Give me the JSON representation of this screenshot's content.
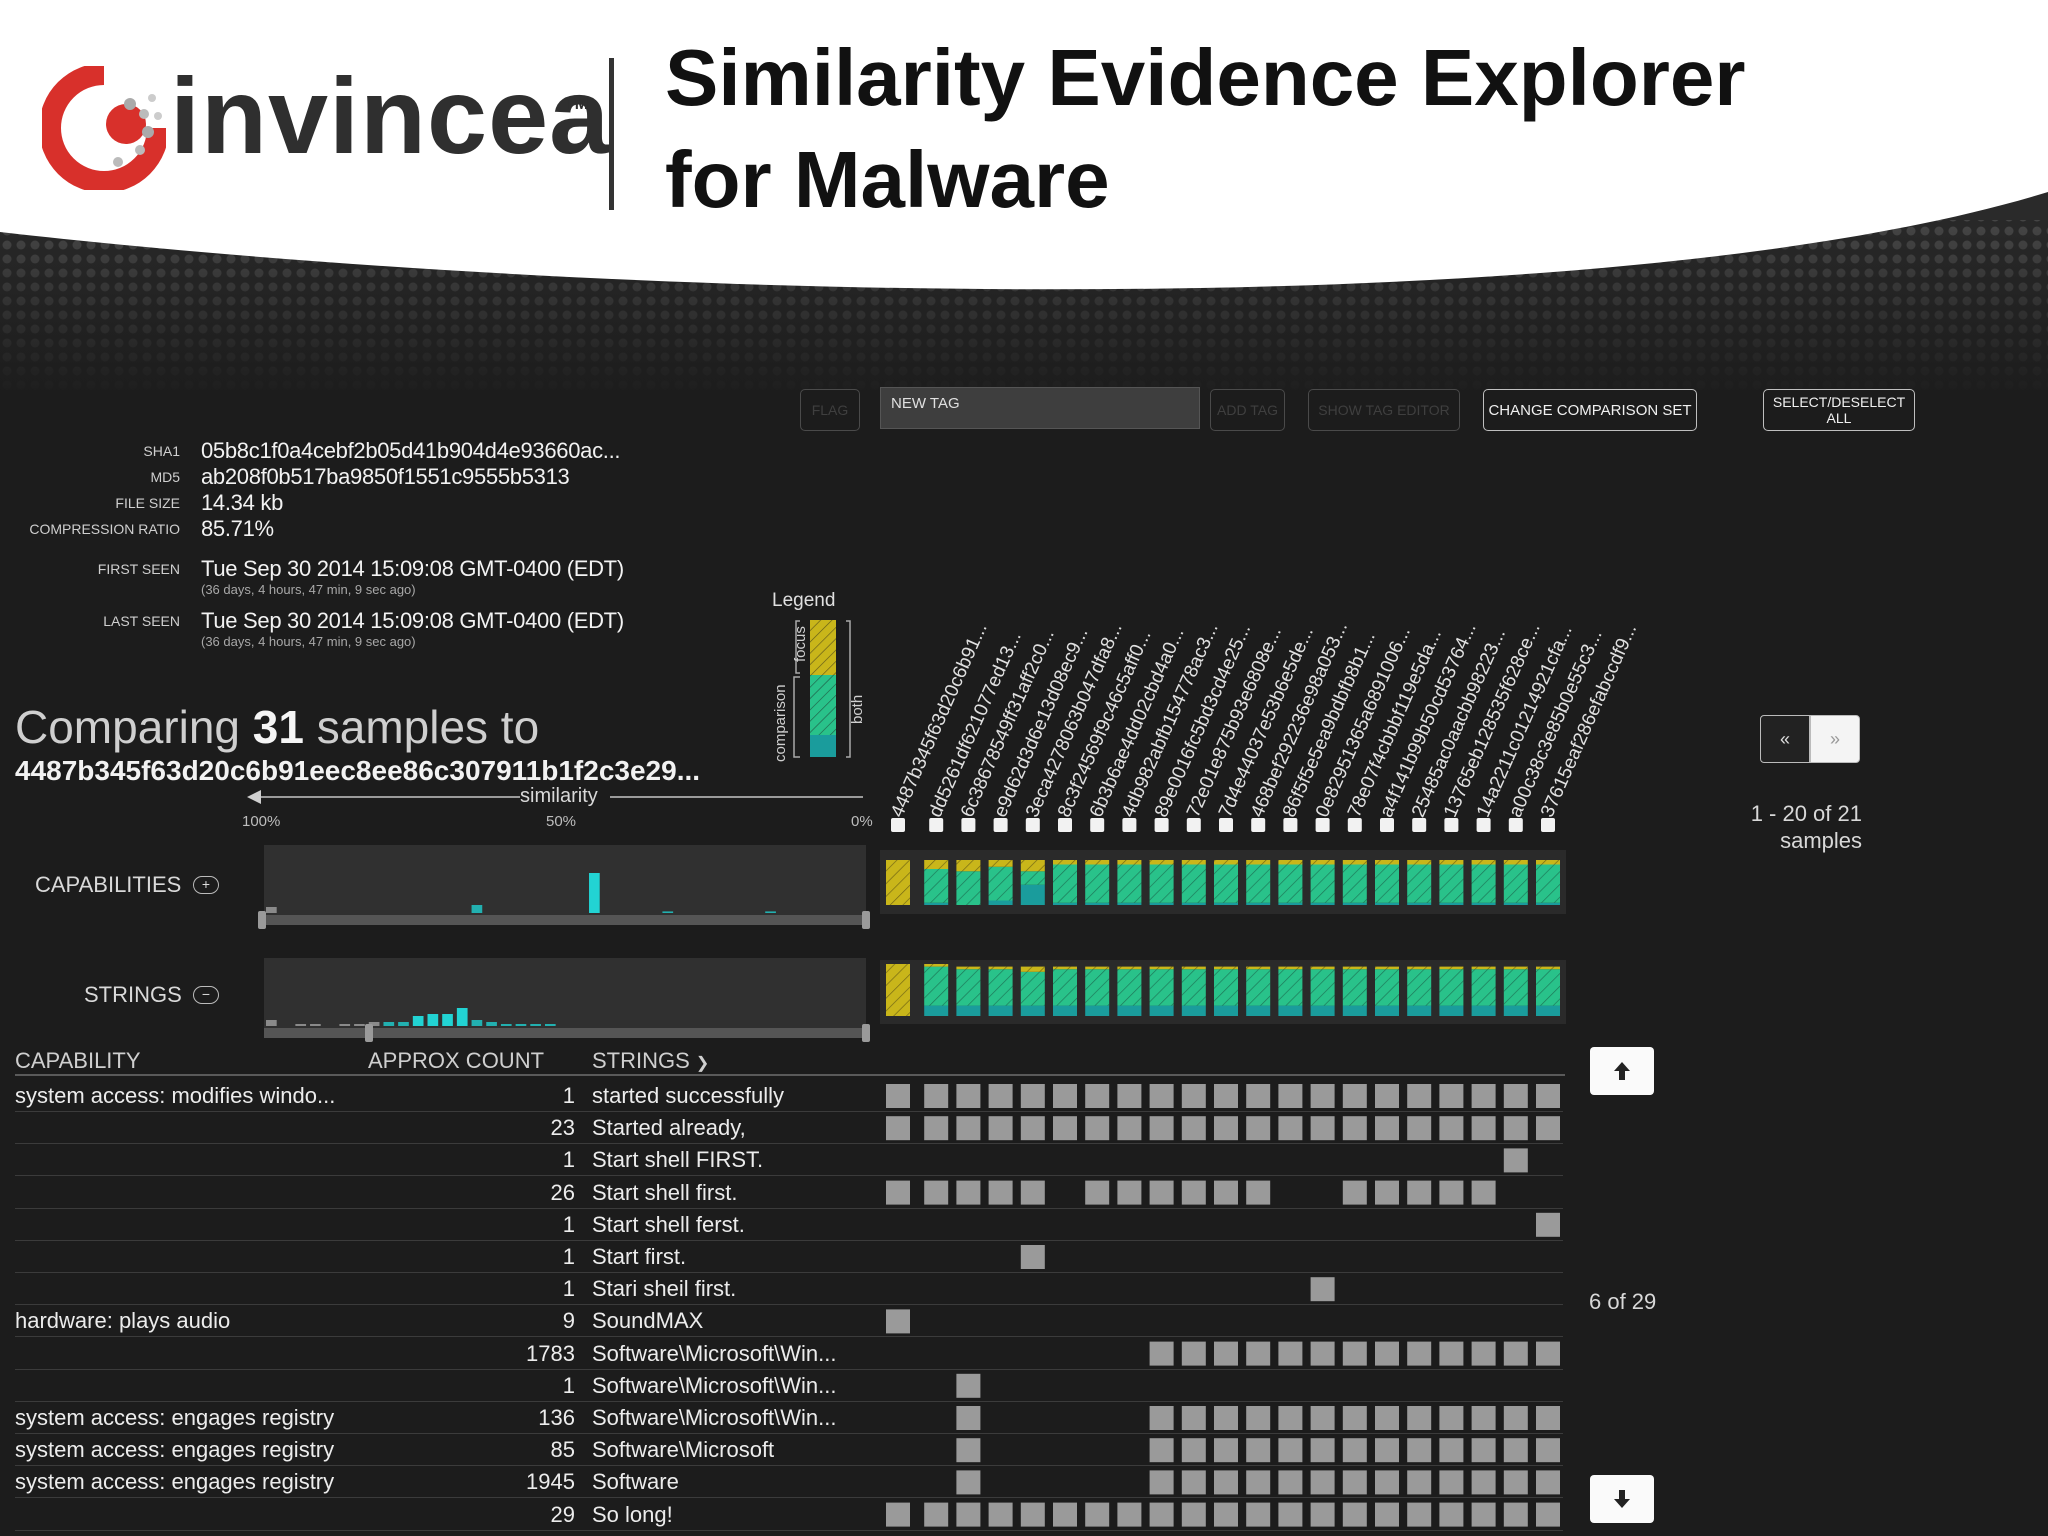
{
  "header": {
    "logo_text": "invincea",
    "logo_tm": "TM",
    "title_line1": "Similarity Evidence Explorer",
    "title_line2": "for Malware"
  },
  "toolbar": {
    "flag_label": "FLAG",
    "tag_placeholder": "NEW TAG",
    "add_tag_label": "ADD TAG",
    "show_tag_editor_label": "SHOW TAG EDITOR",
    "change_comparison_label": "CHANGE COMPARISON SET",
    "select_all_line1": "SELECT/DESELECT",
    "select_all_line2": "ALL"
  },
  "metadata": {
    "sha1_label": "SHA1",
    "sha1": "05b8c1f0a4cebf2b05d41b904d4e93660ac...",
    "md5_label": "MD5",
    "md5": "ab208f0b517ba9850f1551c9555b5313",
    "file_size_label": "FILE SIZE",
    "file_size": "14.34 kb",
    "compression_label": "COMPRESSION RATIO",
    "compression": "85.71%",
    "first_seen_label": "FIRST SEEN",
    "first_seen": "Tue Sep 30 2014 15:09:08 GMT-0400 (EDT)",
    "first_seen_ago": "(36 days, 4 hours, 47 min, 9 sec ago)",
    "last_seen_label": "LAST SEEN",
    "last_seen": "Tue Sep 30 2014 15:09:08 GMT-0400 (EDT)",
    "last_seen_ago": "(36 days, 4 hours, 47 min, 9 sec ago)"
  },
  "comparison": {
    "prefix": "Comparing ",
    "count": "31",
    "suffix": " samples to",
    "target_hash": "4487b345f63d20c6b91eec8ee86c307911b1f2c3e29...",
    "similarity_label": "similarity",
    "tick_100": "100%",
    "tick_50": "50%",
    "tick_0": "0%"
  },
  "legend": {
    "title": "Legend",
    "focus": "focus",
    "comparison": "comparison",
    "both": "both",
    "colors": {
      "focus": "#c9b61a",
      "both": "#29c28a",
      "comparison": "#1a9c9c"
    }
  },
  "sections": {
    "capabilities_label": "CAPABILITIES",
    "capabilities_toggle": "+",
    "strings_label": "STRINGS",
    "strings_toggle": "−"
  },
  "samples": [
    "4487b345f63d20c6b91...",
    "dd5261df621077ed13...",
    "6c38678549ff31aff2c0...",
    "e9d62d3d6e13d08ec9...",
    "3eca4278063b047dfa8...",
    "8c3f24569f9c46c5aff0...",
    "6b3b6ae4dd02cbd4a0...",
    "4db982abfb154778ac3...",
    "89e0016fc5bd3cd4e25...",
    "72e01e875b93e6808e...",
    "7d4e44037e53b6e5de...",
    "468bef292236e98a053...",
    "86f5f5e5ea9bdbfb8b1...",
    "0e82951365a6891006...",
    "78e07f4cbbbf119e5da...",
    "a4f141b99b50cd53764...",
    "25485ac0aacbb98223...",
    "13765eb128535f628ce...",
    "14a2211c01214921cfa...",
    "a00c38c3e85b0e55c3...",
    "37615eaf286efabccdf9..."
  ],
  "pager": {
    "prev": "«",
    "next": "»",
    "range_line1": "1 - 20 of 21",
    "range_line2": "samples",
    "rows_range": "6 of 29"
  },
  "table": {
    "headers": {
      "capability": "CAPABILITY",
      "count": "APPROX COUNT",
      "strings": "STRINGS"
    },
    "rows": [
      {
        "capability": "system access: modifies windo...",
        "count": "1",
        "string": "started successfully"
      },
      {
        "capability": "",
        "count": "23",
        "string": "Started already,"
      },
      {
        "capability": "",
        "count": "1",
        "string": "Start shell FIRST."
      },
      {
        "capability": "",
        "count": "26",
        "string": "Start shell first."
      },
      {
        "capability": "",
        "count": "1",
        "string": "Start shell ferst."
      },
      {
        "capability": "",
        "count": "1",
        "string": "Start first."
      },
      {
        "capability": "",
        "count": "1",
        "string": "Stari sheil first."
      },
      {
        "capability": "hardware: plays audio",
        "count": "9",
        "string": "SoundMAX"
      },
      {
        "capability": "",
        "count": "1783",
        "string": "Software\\Microsoft\\Win..."
      },
      {
        "capability": "",
        "count": "1",
        "string": "Software\\Microsoft\\Win..."
      },
      {
        "capability": "system access: engages registry",
        "count": "136",
        "string": "Software\\Microsoft\\Win..."
      },
      {
        "capability": "system access: engages registry",
        "count": "85",
        "string": "Software\\Microsoft"
      },
      {
        "capability": "system access: engages registry",
        "count": "1945",
        "string": "Software"
      },
      {
        "capability": "",
        "count": "29",
        "string": "So long!"
      }
    ],
    "presence": [
      [
        1,
        1,
        1,
        1,
        1,
        1,
        1,
        1,
        1,
        1,
        1,
        1,
        1,
        1,
        1,
        1,
        1,
        1,
        1,
        1,
        1
      ],
      [
        1,
        1,
        1,
        1,
        1,
        1,
        1,
        1,
        1,
        1,
        1,
        1,
        1,
        1,
        1,
        1,
        1,
        1,
        1,
        1,
        1
      ],
      [
        0,
        0,
        0,
        0,
        0,
        0,
        0,
        0,
        0,
        0,
        0,
        0,
        0,
        0,
        0,
        0,
        0,
        0,
        0,
        1,
        0
      ],
      [
        1,
        1,
        1,
        1,
        1,
        0,
        1,
        1,
        1,
        1,
        1,
        1,
        0,
        0,
        1,
        1,
        1,
        1,
        1,
        0,
        0
      ],
      [
        0,
        0,
        0,
        0,
        0,
        0,
        0,
        0,
        0,
        0,
        0,
        0,
        0,
        0,
        0,
        0,
        0,
        0,
        0,
        0,
        1
      ],
      [
        0,
        0,
        0,
        0,
        1,
        0,
        0,
        0,
        0,
        0,
        0,
        0,
        0,
        0,
        0,
        0,
        0,
        0,
        0,
        0,
        0
      ],
      [
        0,
        0,
        0,
        0,
        0,
        0,
        0,
        0,
        0,
        0,
        0,
        0,
        0,
        1,
        0,
        0,
        0,
        0,
        0,
        0,
        0
      ],
      [
        1,
        0,
        0,
        0,
        0,
        0,
        0,
        0,
        0,
        0,
        0,
        0,
        0,
        0,
        0,
        0,
        0,
        0,
        0,
        0,
        0
      ],
      [
        0,
        0,
        0,
        0,
        0,
        0,
        0,
        0,
        1,
        1,
        1,
        1,
        1,
        1,
        1,
        1,
        1,
        1,
        1,
        1,
        1
      ],
      [
        0,
        0,
        1,
        0,
        0,
        0,
        0,
        0,
        0,
        0,
        0,
        0,
        0,
        0,
        0,
        0,
        0,
        0,
        0,
        0,
        0
      ],
      [
        0,
        0,
        1,
        0,
        0,
        0,
        0,
        0,
        1,
        1,
        1,
        1,
        1,
        1,
        1,
        1,
        1,
        1,
        1,
        1,
        1
      ],
      [
        0,
        0,
        1,
        0,
        0,
        0,
        0,
        0,
        1,
        1,
        1,
        1,
        1,
        1,
        1,
        1,
        1,
        1,
        1,
        1,
        1
      ],
      [
        0,
        0,
        1,
        0,
        0,
        0,
        0,
        0,
        1,
        1,
        1,
        1,
        1,
        1,
        1,
        1,
        1,
        1,
        1,
        1,
        1
      ],
      [
        1,
        1,
        1,
        1,
        1,
        1,
        1,
        1,
        1,
        1,
        1,
        1,
        1,
        1,
        1,
        1,
        1,
        1,
        1,
        1,
        1
      ]
    ]
  },
  "capabilities_bars": {
    "focus": [
      1.0,
      0.2,
      0.25,
      0.15,
      0.25,
      0.1,
      0.1,
      0.1,
      0.1,
      0.1,
      0.1,
      0.1,
      0.1,
      0.1,
      0.1,
      0.1,
      0.1,
      0.1,
      0.1,
      0.1,
      0.1
    ],
    "both": [
      0.0,
      0.75,
      0.75,
      0.75,
      0.3,
      0.85,
      0.85,
      0.85,
      0.85,
      0.85,
      0.85,
      0.85,
      0.85,
      0.85,
      0.85,
      0.85,
      0.85,
      0.85,
      0.85,
      0.85,
      0.85
    ],
    "comparison": [
      0.0,
      0.05,
      0.0,
      0.1,
      0.45,
      0.05,
      0.05,
      0.05,
      0.05,
      0.05,
      0.05,
      0.05,
      0.05,
      0.05,
      0.05,
      0.05,
      0.05,
      0.05,
      0.05,
      0.05,
      0.05
    ]
  },
  "strings_bars": {
    "focus": [
      1.0,
      0.05,
      0.05,
      0.05,
      0.1,
      0.05,
      0.05,
      0.05,
      0.05,
      0.05,
      0.05,
      0.05,
      0.05,
      0.05,
      0.05,
      0.05,
      0.05,
      0.05,
      0.05,
      0.05,
      0.05
    ],
    "both": [
      0.0,
      0.75,
      0.7,
      0.7,
      0.65,
      0.7,
      0.7,
      0.7,
      0.7,
      0.7,
      0.7,
      0.7,
      0.7,
      0.7,
      0.7,
      0.7,
      0.7,
      0.7,
      0.7,
      0.7,
      0.7
    ],
    "comparison": [
      0.0,
      0.2,
      0.2,
      0.2,
      0.2,
      0.2,
      0.2,
      0.2,
      0.2,
      0.2,
      0.2,
      0.2,
      0.2,
      0.2,
      0.2,
      0.2,
      0.2,
      0.2,
      0.2,
      0.2,
      0.2
    ]
  },
  "capabilities_hist": [
    0.15,
    0,
    0,
    0,
    0,
    0,
    0,
    0,
    0,
    0,
    0,
    0,
    0,
    0,
    0.2,
    0,
    0,
    0,
    0,
    0,
    0,
    0,
    1.0,
    0,
    0,
    0,
    0,
    0.04,
    0,
    0,
    0,
    0,
    0,
    0,
    0.04,
    0,
    0,
    0,
    0,
    0,
    0
  ],
  "strings_hist": [
    0.15,
    0,
    0.05,
    0.05,
    0,
    0.05,
    0.05,
    0.1,
    0.1,
    0.1,
    0.25,
    0.3,
    0.3,
    0.45,
    0.15,
    0.1,
    0.05,
    0.05,
    0.05,
    0.05,
    0,
    0,
    0,
    0,
    0,
    0,
    0,
    0,
    0,
    0,
    0,
    0,
    0,
    0,
    0,
    0,
    0,
    0,
    0,
    0,
    0
  ]
}
